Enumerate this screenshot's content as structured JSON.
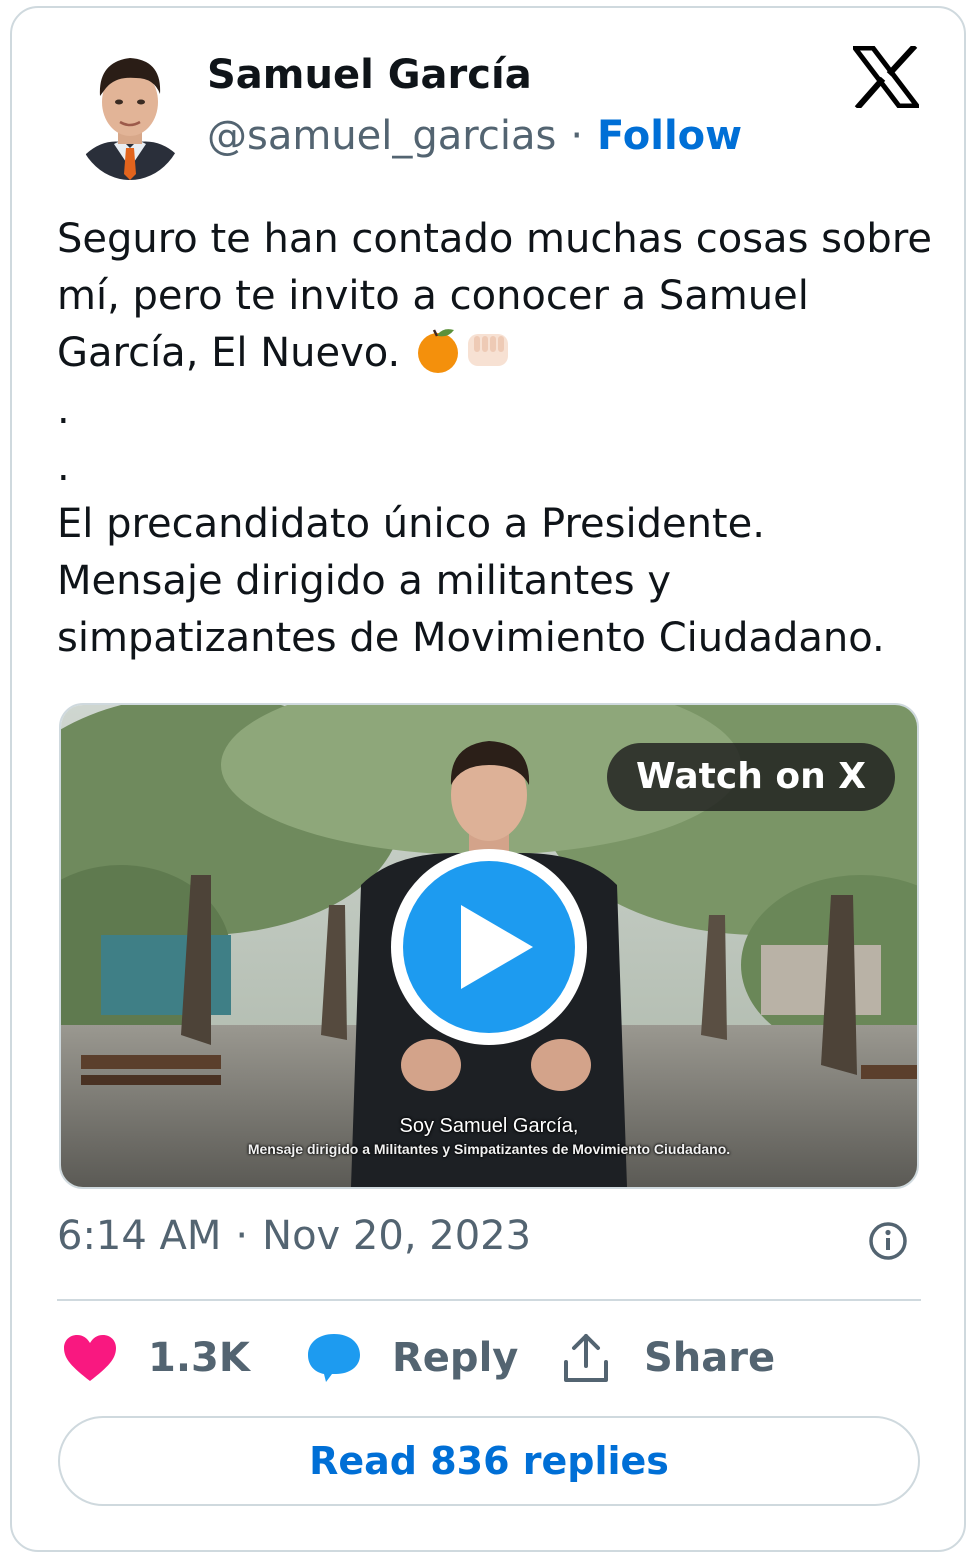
{
  "author": {
    "name": "Samuel García",
    "handle": "@samuel_garcias",
    "separator": "·",
    "follow_label": "Follow"
  },
  "logo_icon": "x-logo-icon",
  "tweet": {
    "lines": [
      "Seguro te han contado muchas cosas sobre",
      "mí, pero te invito a conocer a Samuel",
      "García, El Nuevo.",
      ".",
      ".",
      "El precandidato único a Presidente.",
      "Mensaje dirigido a militantes y",
      "simpatizantes de Movimiento Ciudadano."
    ],
    "emojis": [
      "orange-emoji",
      "fist-emoji"
    ]
  },
  "video": {
    "watch_label": "Watch on X",
    "subtitle_line1": "Soy Samuel García,",
    "subtitle_line2": "Mensaje dirigido a Militantes y Simpatizantes de Movimiento Ciudadano.",
    "play_icon": "play-icon"
  },
  "meta": {
    "time": "6:14 AM",
    "separator": "·",
    "date": "Nov 20, 2023"
  },
  "actions": {
    "like_count": "1.3K",
    "reply_label": "Reply",
    "share_label": "Share"
  },
  "read_replies_label": "Read 836 replies",
  "colors": {
    "like": "#f91880",
    "reply": "#1d9bf0",
    "link": "#006fd6",
    "play": "#1d9bf0",
    "muted": "#536471",
    "border": "#cfd9de"
  }
}
